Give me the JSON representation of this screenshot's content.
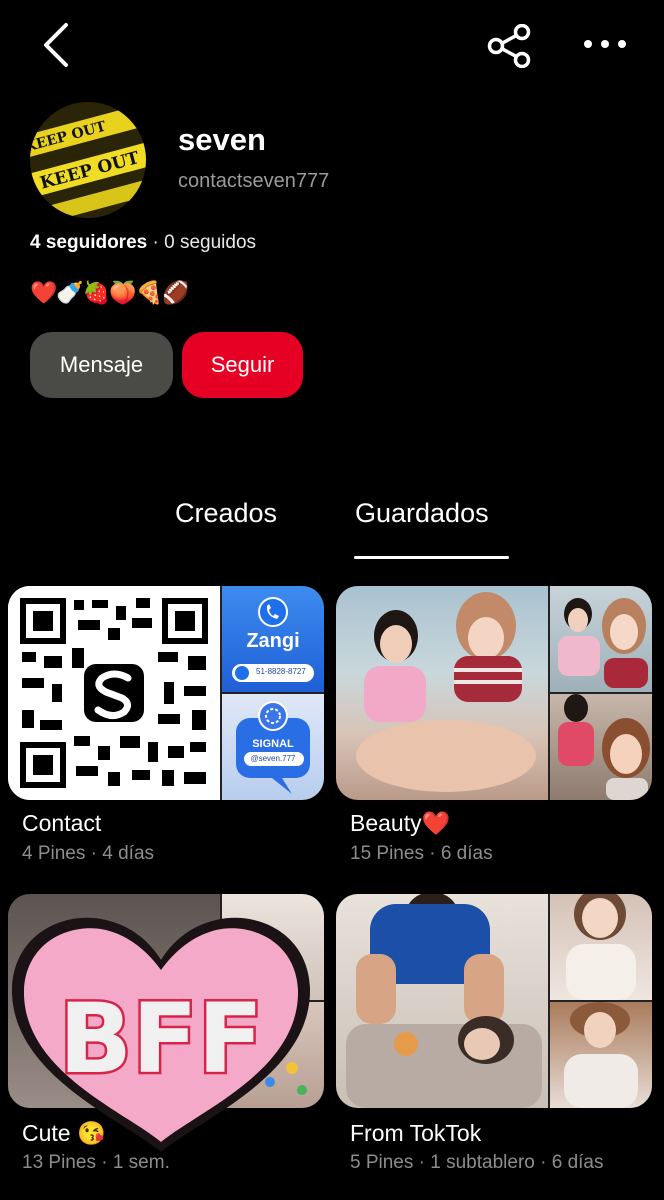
{
  "profile": {
    "name": "seven",
    "handle": "contactseven777",
    "followers": "4 seguidores",
    "separator": " · ",
    "following": "0 seguidos",
    "emojis": "❤️🍼🍓🍑🍕🏈",
    "avatar_text_1": "KEEP OUT",
    "avatar_text_2": "KEEP OUT"
  },
  "actions": {
    "message_label": "Mensaje",
    "follow_label": "Seguir"
  },
  "tabs": {
    "created": "Creados",
    "saved": "Guardados",
    "active": "saved"
  },
  "boards": [
    {
      "title": "Contact",
      "meta": "4 Pines · 4 días",
      "card_zangi": "Zangi",
      "card_zangi_number": "51-8828-8727",
      "card_signal": "SIGNAL",
      "card_signal_handle": "@seven.777"
    },
    {
      "title": "Beauty❤️",
      "meta": "15 Pines · 6 días"
    },
    {
      "title": "Cute 😘",
      "meta": "13 Pines · 1 sem.",
      "sticker": "BFF"
    },
    {
      "title": "From TokTok",
      "meta": "5 Pines · 1 subtablero · 6 días"
    }
  ],
  "icons": [
    "back-icon",
    "share-icon",
    "more-icon"
  ],
  "colors": {
    "accent": "#e60023",
    "button_gray": "#4a4a46",
    "background": "#000000",
    "meta_gray": "#8d8d8d"
  }
}
